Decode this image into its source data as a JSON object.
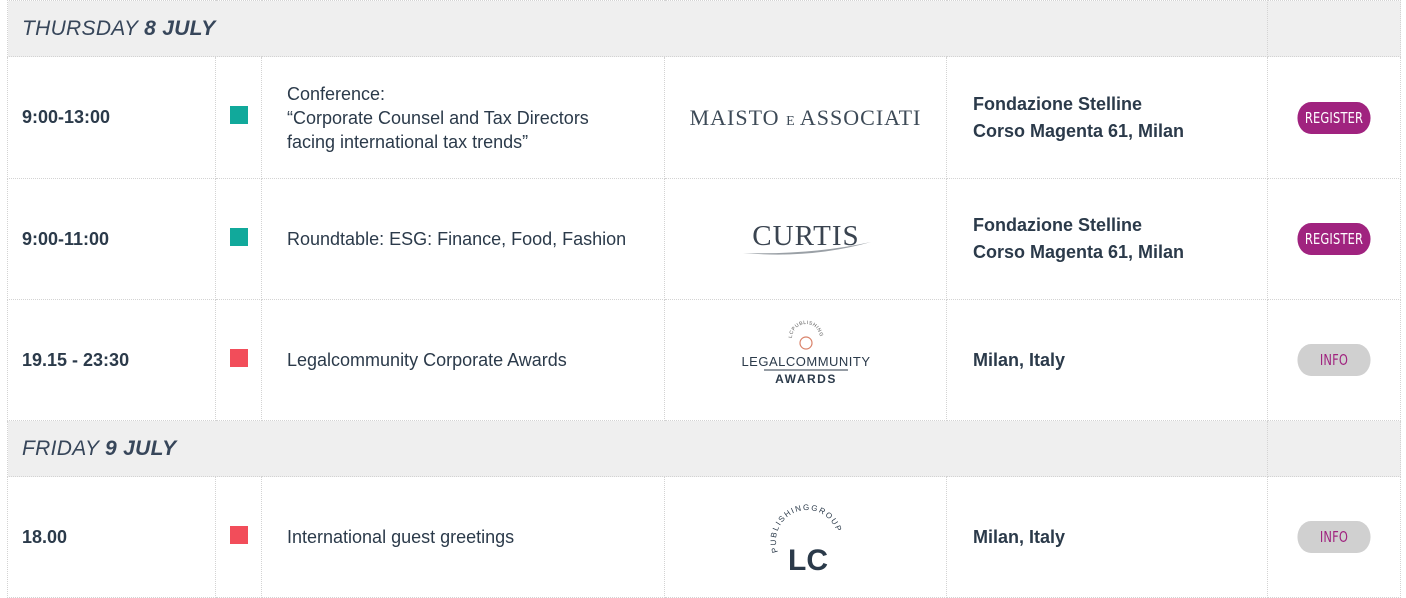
{
  "days": [
    {
      "name": "THURSDAY",
      "date": "8 JULY"
    },
    {
      "name": "FRIDAY",
      "date": "9 JULY"
    }
  ],
  "events": [
    {
      "time": "9:00-13:00",
      "marker_color": "#11a99b",
      "title_lines": [
        "Conference:",
        "“Corporate Counsel and Tax Directors",
        "facing international tax trends”"
      ],
      "logo": {
        "icon": "maisto-e-associati-logo",
        "main": "MAISTO",
        "join": "E",
        "tail": "ASSOCIATI"
      },
      "venue_lines": [
        "Fondazione Stelline",
        "Corso Magenta 61, Milan"
      ],
      "button": "REGISTER"
    },
    {
      "time": "9:00-11:00",
      "marker_color": "#11a99b",
      "title_lines": [
        "Roundtable:  ESG: Finance, Food, Fashion"
      ],
      "logo": {
        "icon": "curtis-logo",
        "text": "CURTIS"
      },
      "venue_lines": [
        "Fondazione Stelline",
        "Corso Magenta 61, Milan"
      ],
      "button": "REGISTER"
    },
    {
      "time": "19.15 - 23:30",
      "marker_color": "#f24d5a",
      "title_lines": [
        "Legalcommunity Corporate Awards"
      ],
      "logo": {
        "icon": "legalcommunity-awards-logo",
        "top": "LCPUBLISHINGGROUP",
        "line1": "LEGALCOMMUNITY",
        "line2": "AWARDS"
      },
      "venue_lines": [
        "Milan, Italy"
      ],
      "button": "INFO"
    },
    {
      "time": "18.00",
      "marker_color": "#f24d5a",
      "title_lines": [
        "International guest greetings"
      ],
      "logo": {
        "icon": "lc-publishing-group-logo",
        "arc": "PUBLISHINGGROUP",
        "text": "LC"
      },
      "venue_lines": [
        "Milan, Italy"
      ],
      "button": "INFO"
    }
  ],
  "colors": {
    "register_bg": "#a0237f",
    "info_bg": "#d0d0d0",
    "day_bg": "#efefef",
    "text": "#2b3a4a"
  }
}
